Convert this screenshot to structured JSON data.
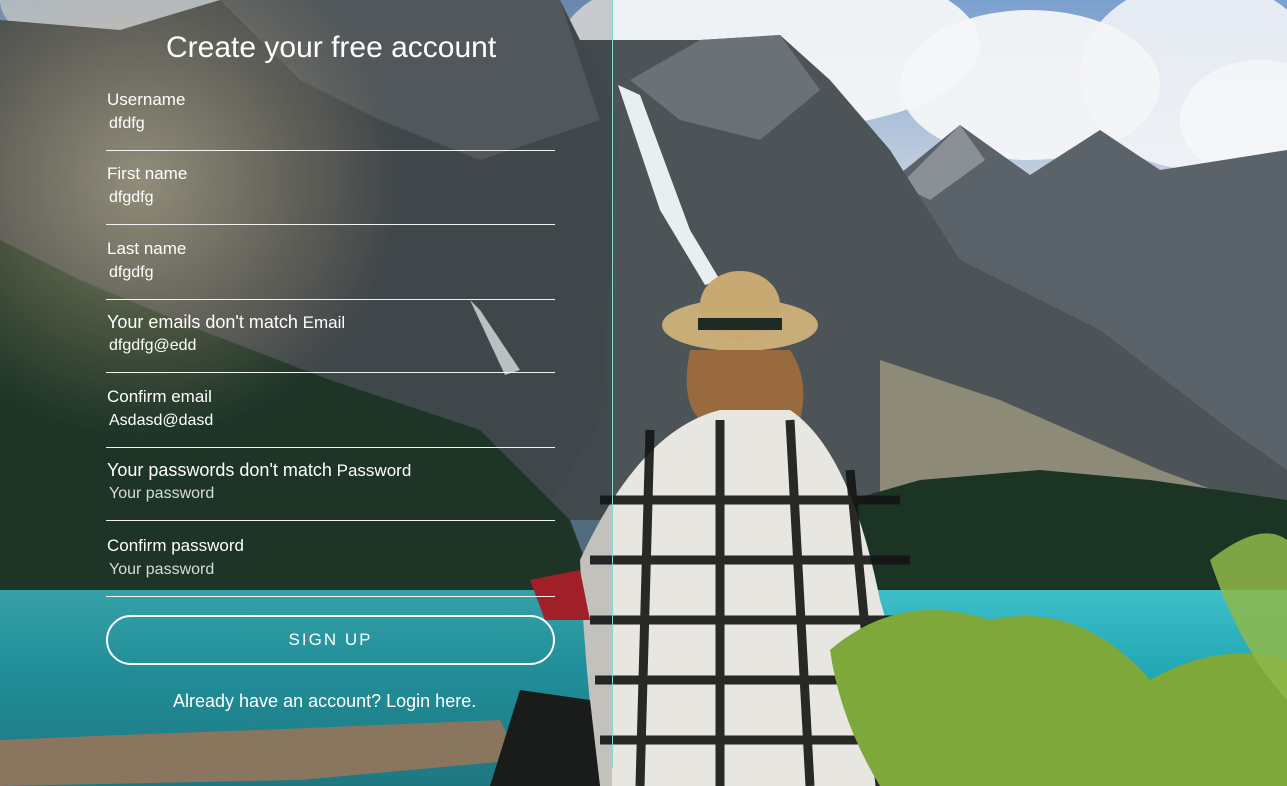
{
  "form": {
    "title": "Create your free account",
    "fields": [
      {
        "label": "Username",
        "value": "dfdfg",
        "placeholder": ""
      },
      {
        "label": "First name",
        "value": "dfgdfg",
        "placeholder": ""
      },
      {
        "label": "Last name",
        "value": "dfgdfg",
        "placeholder": ""
      },
      {
        "error": "Your emails don't match",
        "label": "Email",
        "value": "dfgdfg@edd",
        "placeholder": ""
      },
      {
        "label": "Confirm email",
        "value": "Asdasd@dasd",
        "placeholder": ""
      },
      {
        "error": "Your passwords don't match",
        "label": "Password",
        "value": "",
        "placeholder": "Your password"
      },
      {
        "label": "Confirm password",
        "value": "",
        "placeholder": "Your password"
      }
    ],
    "signup_label": "SIGN UP",
    "login_link": "Already have an account? Login here."
  },
  "theme": {
    "divider_color": "#7fd9cf",
    "text_color": "#ffffff"
  }
}
